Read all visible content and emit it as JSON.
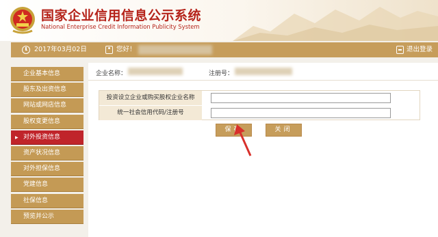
{
  "header": {
    "title_cn": "国家企业信用信息公示系统",
    "title_en": "National Enterprise Credit Information Publicity System"
  },
  "infobar": {
    "date": "2017年03月02日",
    "greeting": "您好！",
    "logout_label": "退出登录"
  },
  "sidebar": {
    "items": [
      {
        "label": "企业基本信息"
      },
      {
        "label": "股东及出资信息"
      },
      {
        "label": "网站或网店信息"
      },
      {
        "label": "股权变更信息"
      },
      {
        "label": "对外投资信息",
        "active": true
      },
      {
        "label": "资产状况信息"
      },
      {
        "label": "对外担保信息"
      },
      {
        "label": "党建信息"
      },
      {
        "label": "社保信息"
      },
      {
        "label": "预览并公示"
      }
    ]
  },
  "main": {
    "company_name_label": "企业名称：",
    "reg_no_label": "注册号：",
    "form": {
      "field1_label": "投资设立企业或购买股权企业名称",
      "field1_value": "",
      "field2_label": "统一社会信用代码/注册号",
      "field2_value": ""
    },
    "save_label": "保存",
    "close_label": "关闭"
  },
  "colors": {
    "brand_gold": "#c69d5b",
    "active_red": "#c0242a",
    "title_red": "#b5231a"
  }
}
